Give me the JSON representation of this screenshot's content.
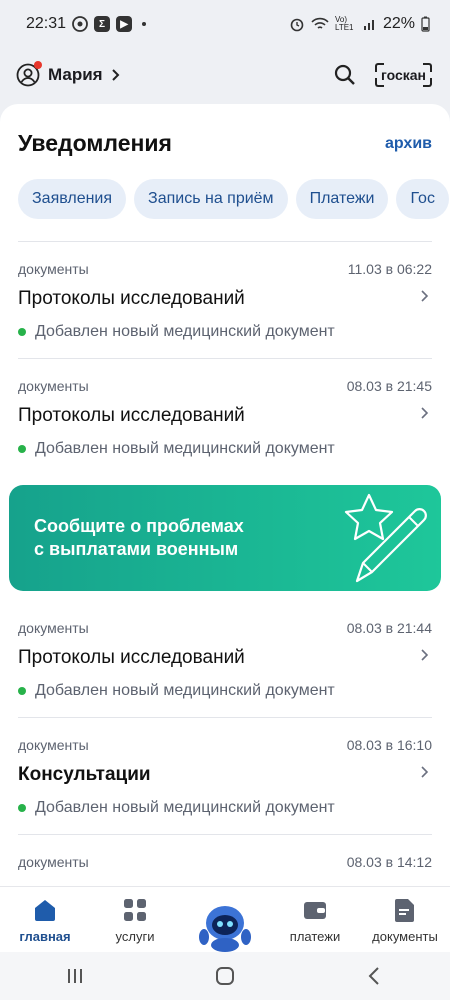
{
  "status": {
    "time": "22:31",
    "app_icons": [
      "whatsapp-icon",
      "sigma-app-icon",
      "youtube-icon"
    ],
    "signal_label": "Vo) LTE1",
    "battery": "22%"
  },
  "header": {
    "profile_name": "Мария",
    "scan_label": "госкан"
  },
  "sheet": {
    "title": "Уведомления",
    "archive_label": "архив",
    "chips": [
      "Заявления",
      "Запись на приём",
      "Платежи",
      "Гос"
    ]
  },
  "notifications": [
    {
      "category": "документы",
      "date": "11.03 в 06:22",
      "title": "Протоколы исследований",
      "status": "Добавлен новый медицинский документ",
      "bold": false
    },
    {
      "category": "документы",
      "date": "08.03 в 21:45",
      "title": "Протоколы исследований",
      "status": "Добавлен новый медицинский документ",
      "bold": false
    },
    {
      "category": "документы",
      "date": "08.03 в 21:44",
      "title": "Протоколы исследований",
      "status": "Добавлен новый медицинский документ",
      "bold": false
    },
    {
      "category": "документы",
      "date": "08.03 в 16:10",
      "title": "Консультации",
      "status": "Добавлен новый медицинский документ",
      "bold": true
    },
    {
      "category": "документы",
      "date": "08.03 в 14:12"
    }
  ],
  "banner": {
    "line1": "Сообщите о проблемах",
    "line2": "с выплатами военным",
    "colors": {
      "start": "#16a28c",
      "end": "#1ec79a"
    }
  },
  "bottom_nav": [
    {
      "label": "главная",
      "icon": "home-icon",
      "active": true
    },
    {
      "label": "услуги",
      "icon": "grid-icon",
      "active": false
    },
    {
      "label": "",
      "icon": "robot-assistant-icon",
      "active": false
    },
    {
      "label": "платежи",
      "icon": "wallet-icon",
      "active": false
    },
    {
      "label": "документы",
      "icon": "document-icon",
      "active": false
    }
  ],
  "colors": {
    "accent": "#1f5cab",
    "status_dot": "#27b24a",
    "chip_bg": "#e7eef8"
  }
}
